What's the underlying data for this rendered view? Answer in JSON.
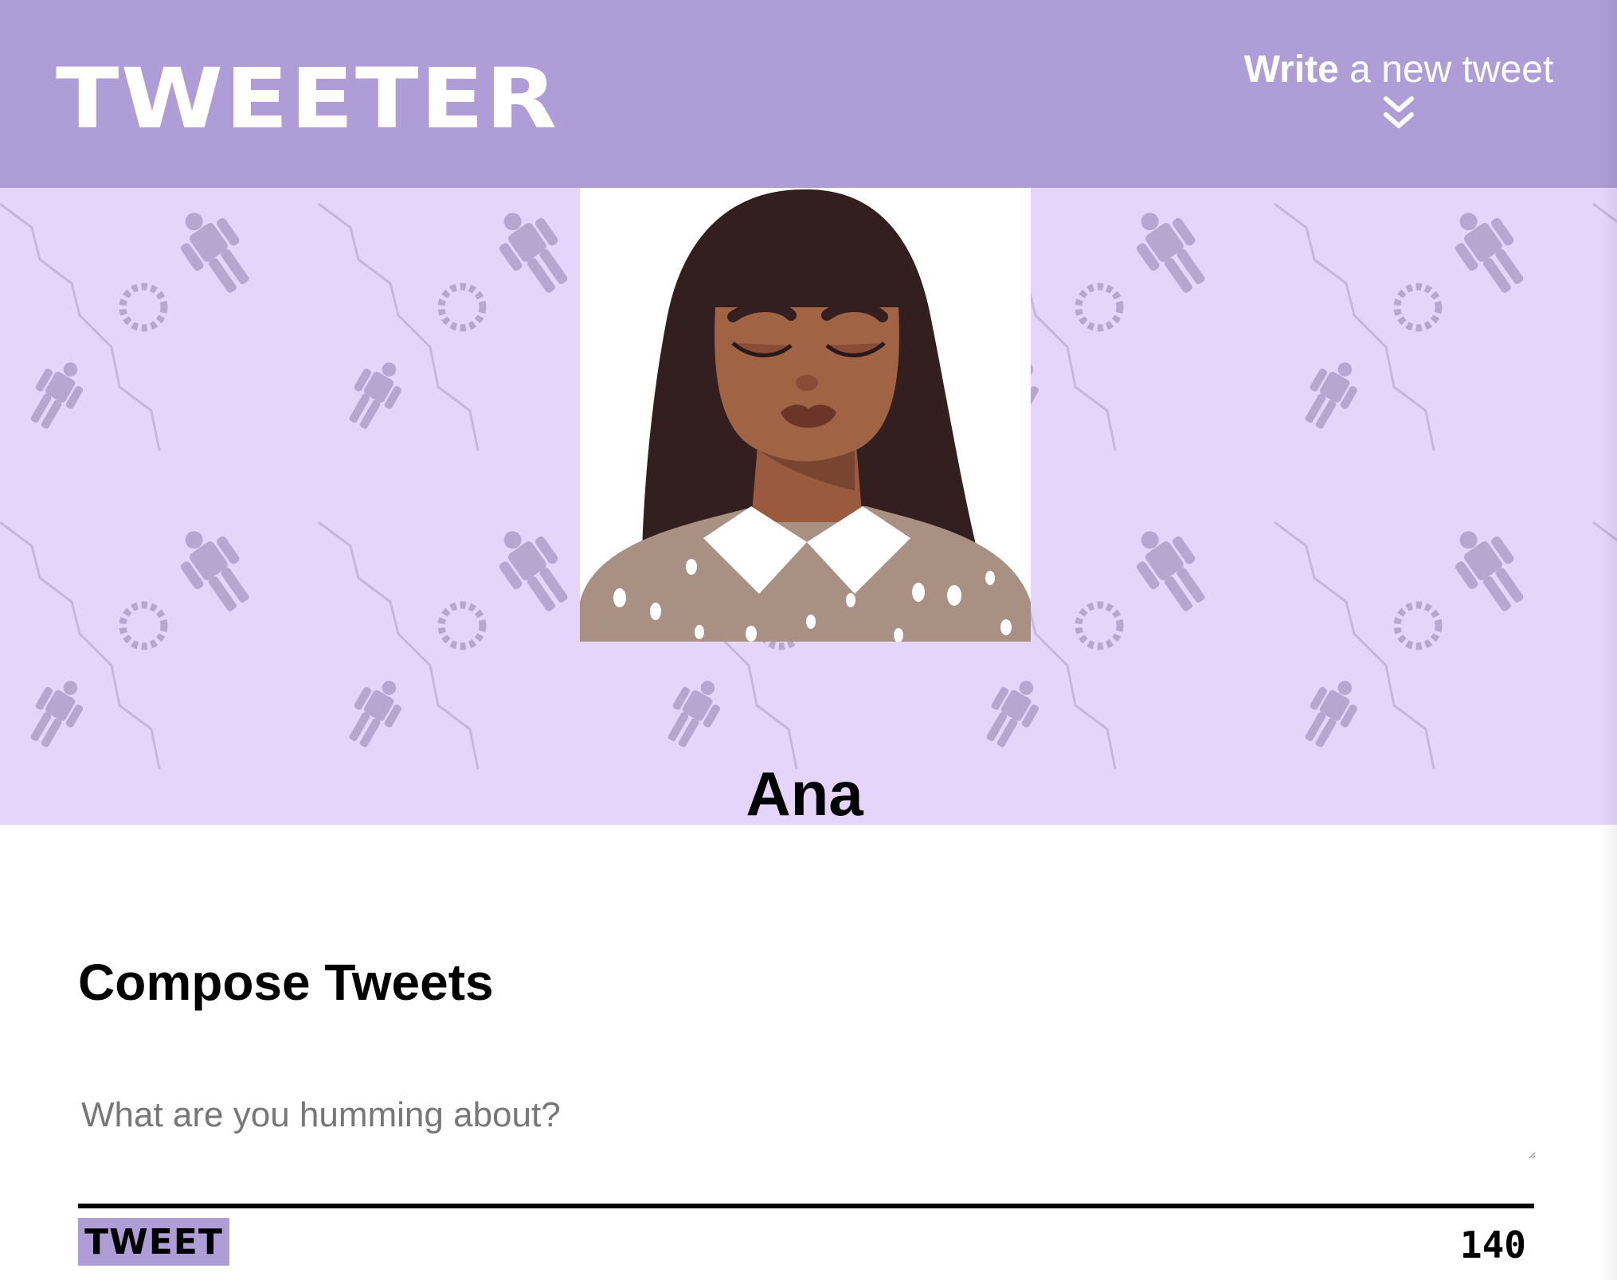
{
  "nav": {
    "brand": "TWEETER",
    "write_bold": "Write",
    "write_rest": " a new tweet",
    "chevron_icon": "double-chevron-down-icon"
  },
  "colors": {
    "nav_bg": "#ae9dd6",
    "hero_bg": "#e6d5fb",
    "pattern": "#b7a6cf",
    "button_bg": "#ae9dd6"
  },
  "profile": {
    "name": "Ana",
    "avatar_icon": "woman-avatar-illustration"
  },
  "compose": {
    "title": "Compose Tweets",
    "placeholder": "What are you humming about?",
    "value": "",
    "submit_label": "TWEET",
    "char_count": "140"
  }
}
